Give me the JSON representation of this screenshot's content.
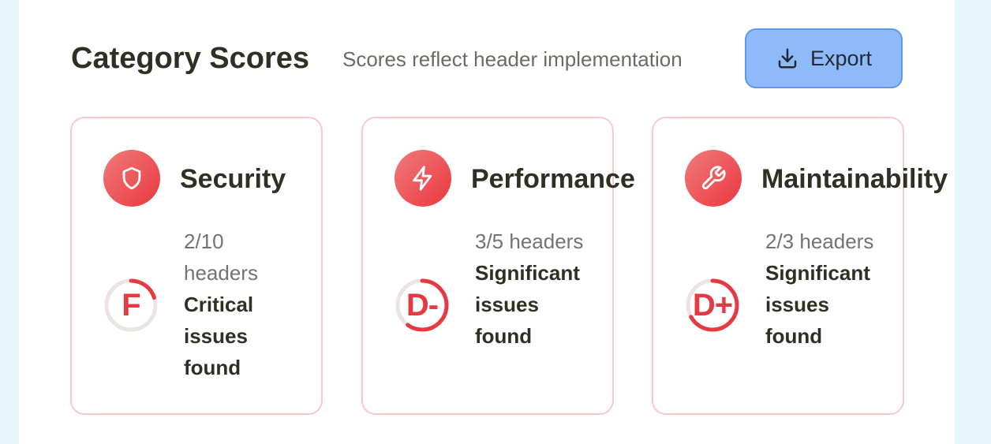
{
  "header": {
    "title": "Category Scores",
    "subtitle": "Scores reflect header implementation",
    "export_label": "Export"
  },
  "colors": {
    "accent_red": "#e63a43",
    "card_border": "#f8c9c9",
    "export_bg": "#8fbaf9",
    "gauge_track": "#ece4e2"
  },
  "cards": [
    {
      "icon": "shield-icon",
      "title": "Security",
      "grade": "F",
      "score": 0.2,
      "count": "2/10 headers",
      "status": "Critical issues found"
    },
    {
      "icon": "lightning-icon",
      "title": "Performance",
      "grade": "D-",
      "score": 0.6,
      "count": "3/5 headers",
      "status": "Significant issues found"
    },
    {
      "icon": "wrench-icon",
      "title": "Maintainability",
      "grade": "D+",
      "score": 0.67,
      "count": "2/3 headers",
      "status": "Significant issues found"
    }
  ]
}
